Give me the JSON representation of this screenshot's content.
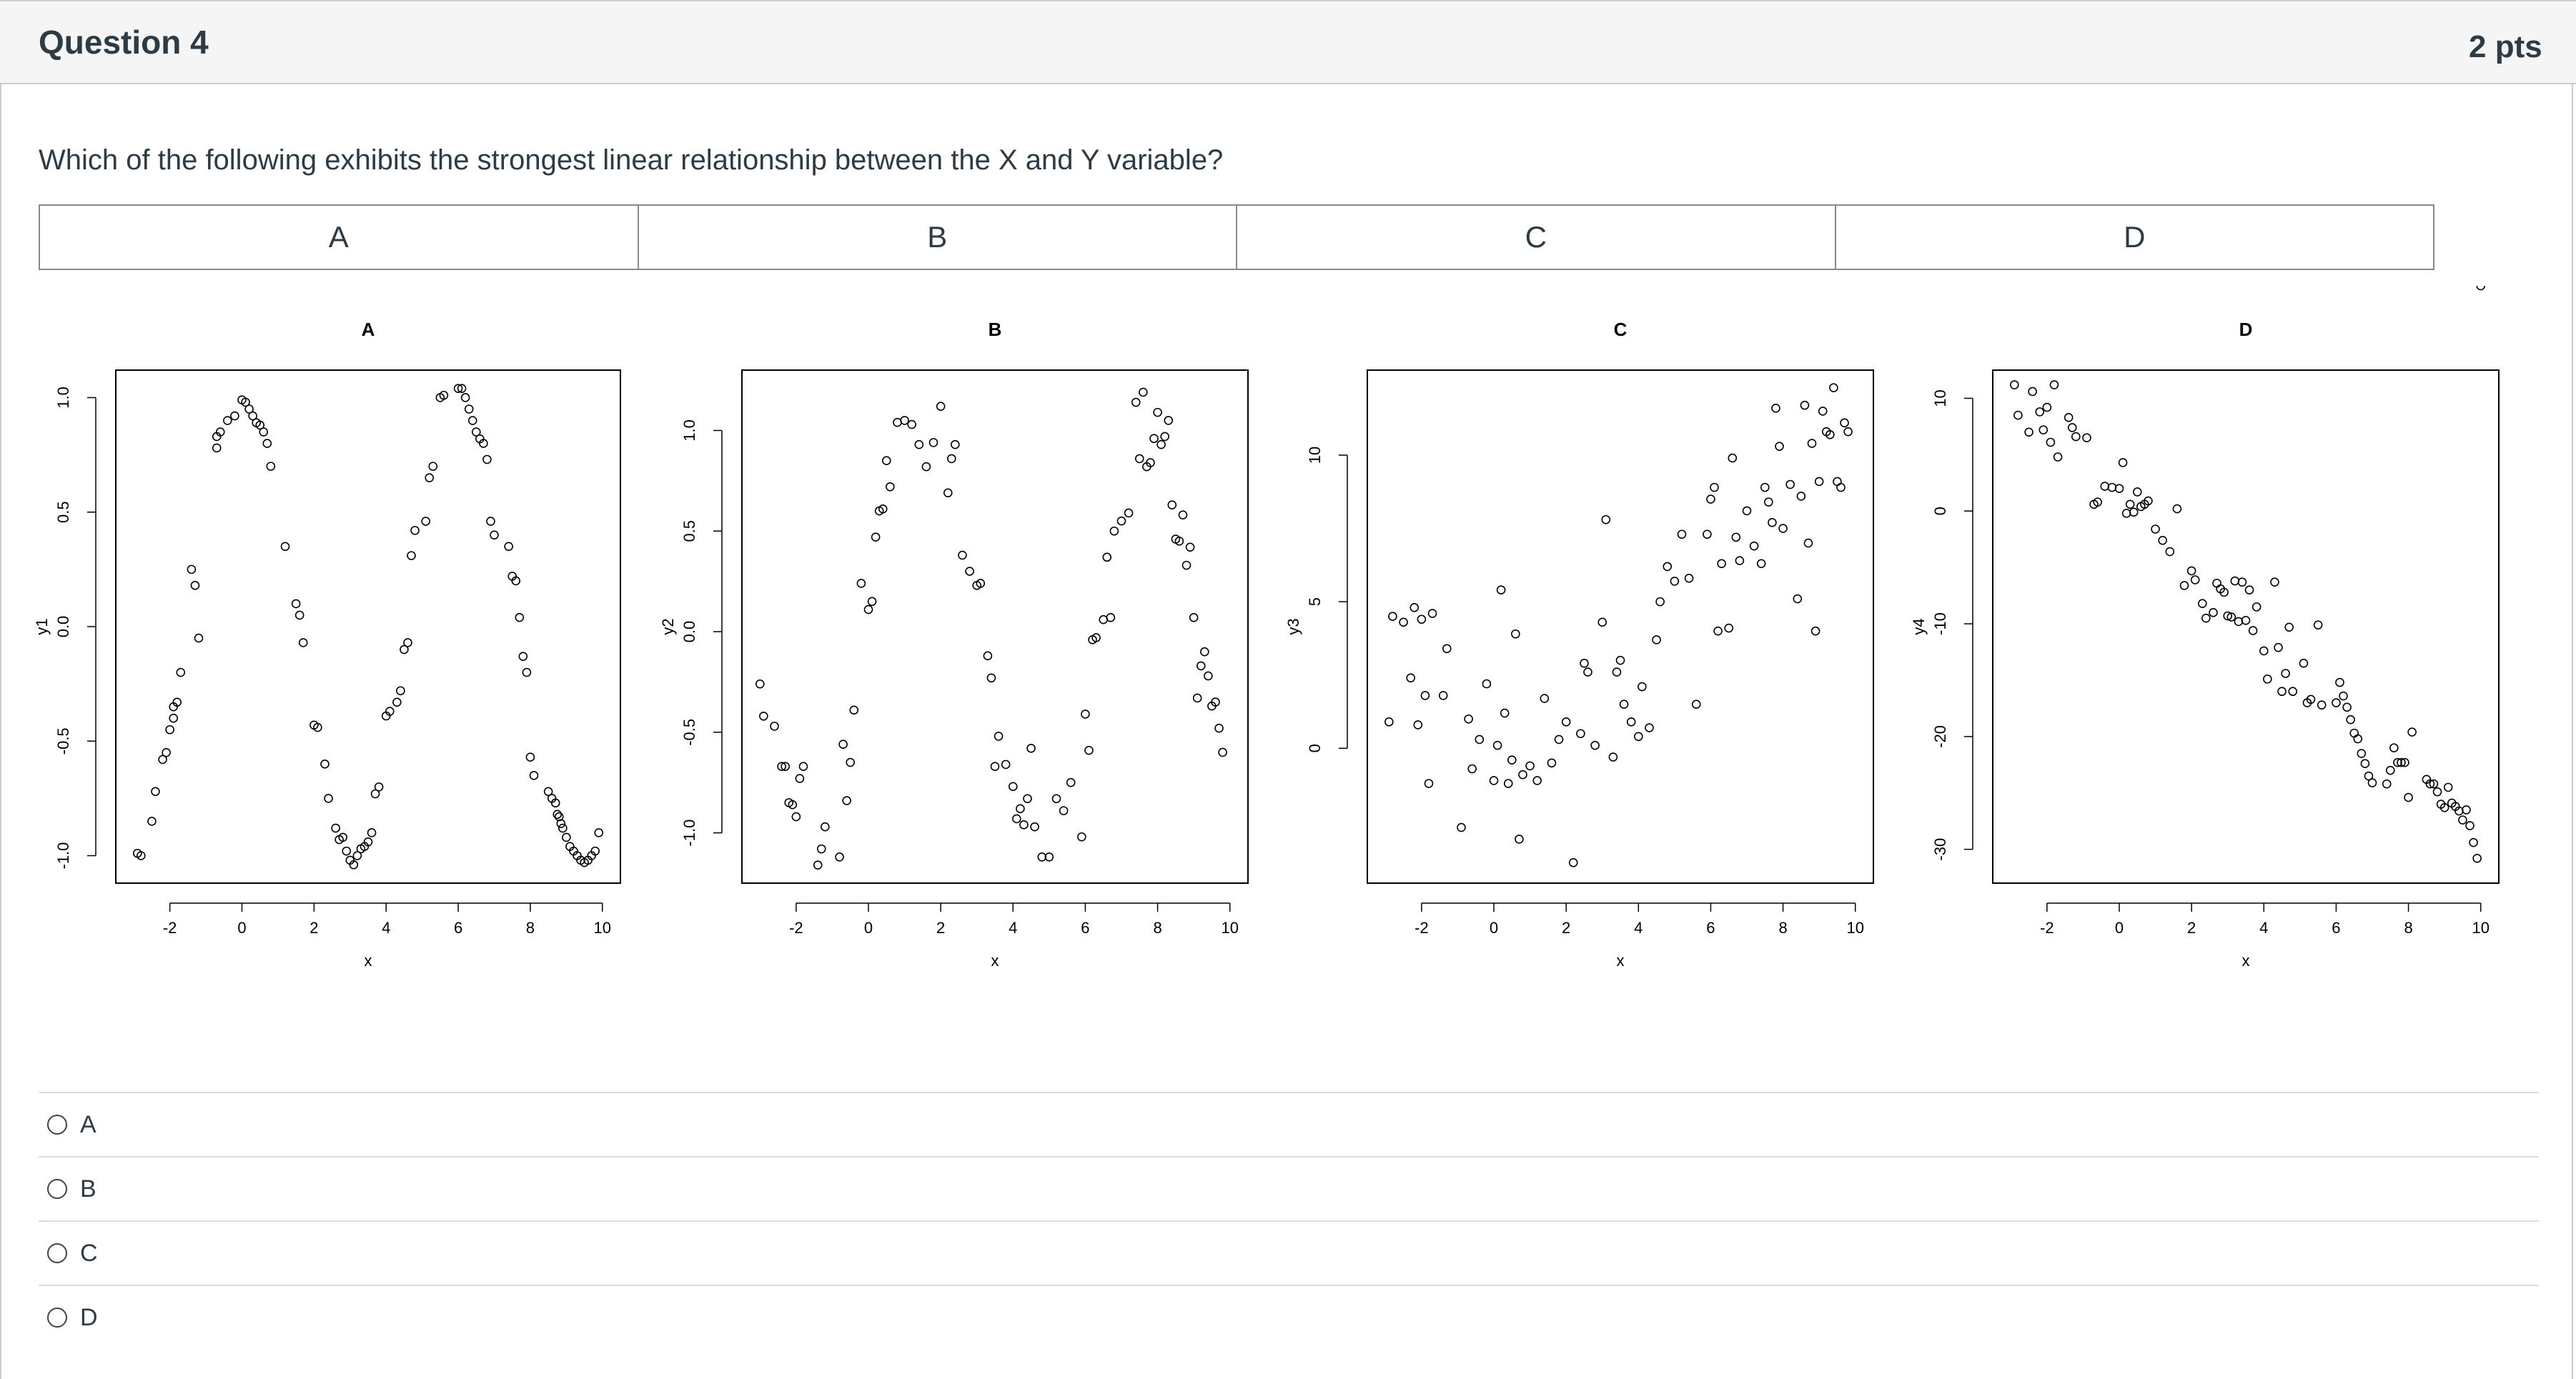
{
  "question": {
    "title": "Question 4",
    "points": "2 pts",
    "prompt": "Which of the following exhibits the strongest linear relationship between the X and Y variable?"
  },
  "label_table": [
    "A",
    "B",
    "C",
    "D"
  ],
  "answers": [
    {
      "label": "A",
      "selected": false
    },
    {
      "label": "B",
      "selected": false
    },
    {
      "label": "C",
      "selected": false
    },
    {
      "label": "D",
      "selected": false
    }
  ],
  "chart_data": [
    {
      "type": "scatter",
      "title": "A",
      "xlabel": "x",
      "ylabel": "y1",
      "xlim": [
        -3.5,
        10.5
      ],
      "ylim": [
        -1.12,
        1.12
      ],
      "xticks": [
        -2,
        0,
        2,
        4,
        6,
        8,
        10
      ],
      "yticks": [
        -1.0,
        -0.5,
        0.0,
        0.5,
        1.0
      ],
      "ytick_labels": [
        "-1.0",
        "-0.5",
        "0.0",
        "0.5",
        "1.0"
      ],
      "points": {
        "x": [
          -2.9,
          -2.8,
          -2.5,
          -2.4,
          -2.2,
          -2.1,
          -2.0,
          -1.9,
          -1.9,
          -1.8,
          -1.7,
          -1.4,
          -1.3,
          -1.2,
          -0.7,
          -0.7,
          -0.6,
          -0.4,
          -0.2,
          0.0,
          0.1,
          0.2,
          0.3,
          0.4,
          0.5,
          0.6,
          0.7,
          0.8,
          1.2,
          1.5,
          1.6,
          1.7,
          2.0,
          2.1,
          2.3,
          2.4,
          2.6,
          2.7,
          2.8,
          2.9,
          3.0,
          3.1,
          3.2,
          3.3,
          3.4,
          3.5,
          3.6,
          3.7,
          3.8,
          4.0,
          4.1,
          4.3,
          4.4,
          4.5,
          4.6,
          4.7,
          4.8,
          5.1,
          5.2,
          5.3,
          5.5,
          5.6,
          6.0,
          6.1,
          6.2,
          6.3,
          6.4,
          6.5,
          6.6,
          6.7,
          6.8,
          6.9,
          7.0,
          7.4,
          7.5,
          7.6,
          7.7,
          7.8,
          7.9,
          8.0,
          8.1,
          8.5,
          8.6,
          8.7,
          8.75,
          8.8,
          8.85,
          8.9,
          9.0,
          9.1,
          9.2,
          9.3,
          9.4,
          9.5,
          9.6,
          9.7,
          9.8,
          9.9
        ],
        "y": [
          -0.99,
          -1.0,
          -0.85,
          -0.72,
          -0.58,
          -0.55,
          -0.45,
          -0.4,
          -0.35,
          -0.33,
          -0.2,
          0.25,
          0.18,
          -0.05,
          0.78,
          0.83,
          0.85,
          0.9,
          0.92,
          0.99,
          0.98,
          0.95,
          0.92,
          0.89,
          0.88,
          0.85,
          0.8,
          0.7,
          0.35,
          0.1,
          0.05,
          -0.07,
          -0.43,
          -0.44,
          -0.6,
          -0.75,
          -0.88,
          -0.93,
          -0.92,
          -0.98,
          -1.02,
          -1.04,
          -1.0,
          -0.97,
          -0.96,
          -0.94,
          -0.9,
          -0.73,
          -0.7,
          -0.39,
          -0.37,
          -0.33,
          -0.28,
          -0.1,
          -0.07,
          0.31,
          0.42,
          0.46,
          0.65,
          0.7,
          1.0,
          1.01,
          1.04,
          1.04,
          1.0,
          0.95,
          0.9,
          0.85,
          0.82,
          0.8,
          0.73,
          0.46,
          0.4,
          0.35,
          0.22,
          0.2,
          0.04,
          -0.13,
          -0.2,
          -0.57,
          -0.65,
          -0.72,
          -0.75,
          -0.77,
          -0.82,
          -0.83,
          -0.86,
          -0.88,
          -0.92,
          -0.96,
          -0.98,
          -1.0,
          -1.02,
          -1.03,
          -1.02,
          -1.0,
          -0.98,
          -0.9
        ]
      }
    },
    {
      "type": "scatter",
      "title": "B",
      "xlabel": "x",
      "ylabel": "y2",
      "xlim": [
        -3.5,
        10.5
      ],
      "ylim": [
        -1.25,
        1.3
      ],
      "xticks": [
        -2,
        0,
        2,
        4,
        6,
        8,
        10
      ],
      "yticks": [
        -1.0,
        -0.5,
        0.0,
        0.5,
        1.0
      ],
      "ytick_labels": [
        "-1.0",
        "-0.5",
        "0.0",
        "0.5",
        "1.0"
      ],
      "points": {
        "x": [
          -3.0,
          -2.9,
          -2.6,
          -2.4,
          -2.3,
          -2.2,
          -2.1,
          -2.0,
          -1.9,
          -1.8,
          -1.4,
          -1.3,
          -1.2,
          -0.8,
          -0.7,
          -0.6,
          -0.5,
          -0.4,
          -0.2,
          0.0,
          0.1,
          0.2,
          0.3,
          0.4,
          0.5,
          0.6,
          0.8,
          1.0,
          1.2,
          1.4,
          1.6,
          1.8,
          2.0,
          2.2,
          2.3,
          2.4,
          2.6,
          2.8,
          3.0,
          3.1,
          3.3,
          3.4,
          3.5,
          3.6,
          3.8,
          4.0,
          4.1,
          4.2,
          4.3,
          4.4,
          4.5,
          4.6,
          4.8,
          5.0,
          5.2,
          5.4,
          5.6,
          5.9,
          6.0,
          6.1,
          6.2,
          6.3,
          6.5,
          6.6,
          6.7,
          6.8,
          7.0,
          7.2,
          7.4,
          7.5,
          7.6,
          7.7,
          7.8,
          7.9,
          8.0,
          8.1,
          8.2,
          8.3,
          8.4,
          8.5,
          8.6,
          8.7,
          8.8,
          8.9,
          9.0,
          9.1,
          9.2,
          9.3,
          9.4,
          9.5,
          9.6,
          9.7,
          9.8
        ],
        "y": [
          -0.26,
          -0.42,
          -0.47,
          -0.67,
          -0.67,
          -0.85,
          -0.86,
          -0.92,
          -0.73,
          -0.67,
          -1.16,
          -1.08,
          -0.97,
          -1.12,
          -0.56,
          -0.84,
          -0.65,
          -0.39,
          0.24,
          0.11,
          0.15,
          0.47,
          0.6,
          0.61,
          0.85,
          0.72,
          1.04,
          1.05,
          1.03,
          0.93,
          0.82,
          0.94,
          1.12,
          0.69,
          0.86,
          0.93,
          0.38,
          0.3,
          0.23,
          0.24,
          -0.12,
          -0.23,
          -0.67,
          -0.52,
          -0.66,
          -0.77,
          -0.93,
          -0.88,
          -0.96,
          -0.83,
          -0.58,
          -0.97,
          -1.12,
          -1.12,
          -0.83,
          -0.89,
          -0.75,
          -1.02,
          -0.41,
          -0.59,
          -0.04,
          -0.03,
          0.06,
          0.37,
          0.07,
          0.5,
          0.55,
          0.59,
          1.14,
          0.86,
          1.19,
          0.82,
          0.84,
          0.96,
          1.09,
          0.93,
          0.97,
          1.05,
          0.63,
          0.46,
          0.45,
          0.58,
          0.33,
          0.42,
          0.07,
          -0.33,
          -0.17,
          -0.1,
          -0.22,
          -0.37,
          -0.35,
          -0.48,
          -0.6
        ]
      }
    },
    {
      "type": "scatter",
      "title": "C",
      "xlabel": "x",
      "ylabel": "y3",
      "xlim": [
        -3.5,
        10.5
      ],
      "ylim": [
        -4.6,
        12.9
      ],
      "xticks": [
        -2,
        0,
        2,
        4,
        6,
        8,
        10
      ],
      "yticks": [
        0,
        5,
        10
      ],
      "ytick_labels": [
        "0",
        "5",
        "10"
      ],
      "points": {
        "x": [
          -2.9,
          -2.8,
          -2.5,
          -2.3,
          -2.2,
          -2.1,
          -2.0,
          -1.9,
          -1.8,
          -1.7,
          -1.4,
          -1.3,
          -0.9,
          -0.7,
          -0.6,
          -0.4,
          -0.2,
          0.0,
          0.1,
          0.2,
          0.3,
          0.4,
          0.5,
          0.6,
          0.7,
          0.8,
          1.0,
          1.2,
          1.4,
          1.6,
          1.8,
          2.0,
          2.2,
          2.4,
          2.5,
          2.6,
          2.8,
          3.0,
          3.1,
          3.3,
          3.4,
          3.5,
          3.6,
          3.8,
          4.0,
          4.1,
          4.3,
          4.5,
          4.6,
          4.8,
          5.0,
          5.2,
          5.4,
          5.6,
          5.9,
          6.0,
          6.1,
          6.2,
          6.3,
          6.5,
          6.6,
          6.7,
          6.8,
          7.0,
          7.2,
          7.4,
          7.5,
          7.6,
          7.7,
          7.8,
          7.9,
          8.0,
          8.2,
          8.4,
          8.5,
          8.6,
          8.7,
          8.8,
          8.9,
          9.0,
          9.1,
          9.2,
          9.3,
          9.4,
          9.5,
          9.6,
          9.7,
          9.8
        ],
        "y": [
          0.9,
          4.5,
          4.3,
          2.4,
          4.8,
          0.8,
          4.4,
          1.8,
          -1.2,
          4.6,
          1.8,
          3.4,
          -2.7,
          1.0,
          -0.7,
          0.3,
          2.2,
          -1.1,
          0.1,
          5.4,
          1.2,
          -1.2,
          -0.4,
          3.9,
          -3.1,
          -0.9,
          -0.6,
          -1.1,
          1.7,
          -0.5,
          0.3,
          0.9,
          -3.9,
          0.5,
          2.9,
          2.6,
          0.1,
          4.3,
          7.8,
          -0.3,
          2.6,
          3.0,
          1.5,
          0.9,
          0.4,
          2.1,
          0.7,
          3.7,
          5.0,
          6.2,
          5.7,
          7.3,
          5.8,
          1.5,
          7.3,
          8.5,
          8.9,
          4.0,
          6.3,
          4.1,
          9.9,
          7.2,
          6.4,
          8.1,
          6.9,
          6.3,
          8.9,
          8.4,
          7.7,
          11.6,
          10.3,
          7.5,
          9.0,
          5.1,
          8.6,
          11.7,
          7.0,
          10.4,
          4.0,
          9.1,
          11.5,
          10.8,
          10.7,
          12.3,
          9.1,
          8.9,
          11.1,
          10.8
        ]
      }
    },
    {
      "type": "scatter",
      "title": "D",
      "xlabel": "x",
      "ylabel": "y4",
      "xlim": [
        -3.5,
        10.5
      ],
      "ylim": [
        -33.0,
        12.5
      ],
      "xticks": [
        -2,
        0,
        2,
        4,
        6,
        8,
        10
      ],
      "yticks": [
        -30,
        -20,
        -10,
        0,
        10
      ],
      "ytick_labels": [
        "-30",
        "-20",
        "-10",
        "0",
        "10"
      ],
      "points": {
        "x": [
          -2.9,
          -2.8,
          -2.5,
          -2.4,
          -2.2,
          -2.1,
          -2.0,
          -1.9,
          -1.8,
          -1.7,
          -1.4,
          -1.3,
          -1.2,
          -0.9,
          -0.7,
          -0.6,
          -0.4,
          -0.2,
          0.0,
          0.1,
          0.2,
          0.3,
          0.4,
          0.5,
          0.6,
          0.7,
          0.8,
          1.0,
          1.2,
          1.4,
          1.6,
          1.8,
          2.0,
          2.1,
          2.3,
          2.4,
          2.6,
          2.7,
          2.8,
          2.9,
          3.0,
          3.1,
          3.2,
          3.3,
          3.4,
          3.5,
          3.6,
          3.7,
          3.8,
          4.0,
          4.1,
          4.3,
          4.4,
          4.5,
          4.6,
          4.7,
          4.8,
          5.1,
          5.2,
          5.3,
          5.5,
          5.6,
          6.0,
          6.1,
          6.2,
          6.3,
          6.4,
          6.5,
          6.6,
          6.7,
          6.8,
          6.9,
          7.0,
          7.4,
          7.5,
          7.6,
          7.7,
          7.8,
          7.9,
          8.0,
          8.1,
          8.5,
          8.6,
          8.7,
          8.8,
          8.9,
          9.0,
          9.1,
          9.2,
          9.3,
          9.4,
          9.5,
          9.6,
          9.7,
          9.8,
          9.9,
          10.0
        ],
        "y": [
          11.2,
          8.5,
          7.0,
          10.6,
          8.8,
          7.2,
          9.2,
          6.1,
          11.2,
          4.8,
          8.3,
          7.4,
          6.6,
          6.5,
          0.6,
          0.8,
          2.2,
          2.1,
          2.0,
          4.3,
          -0.2,
          0.6,
          -0.1,
          1.7,
          0.4,
          0.6,
          0.9,
          -1.6,
          -2.6,
          -3.6,
          0.2,
          -6.6,
          -5.3,
          -6.1,
          -8.2,
          -9.5,
          -9.0,
          -6.4,
          -6.9,
          -7.2,
          -9.3,
          -9.4,
          -6.2,
          -9.8,
          -6.3,
          -9.7,
          -7.0,
          -10.6,
          -8.5,
          -12.4,
          -14.9,
          -6.3,
          -12.1,
          -16.0,
          -14.4,
          -10.3,
          -16.0,
          -13.5,
          -17.0,
          -16.7,
          -10.1,
          -17.2,
          -17.0,
          -15.2,
          -16.4,
          -17.4,
          -18.5,
          -19.7,
          -20.2,
          -21.5,
          -22.4,
          -23.5,
          -24.1,
          -24.2,
          -23.0,
          -21.0,
          -22.3,
          -22.3,
          -22.3,
          -25.4,
          -19.6,
          -23.8,
          -24.2,
          -24.2,
          -24.9,
          -26.0,
          -26.3,
          -24.5,
          -25.9,
          -26.2,
          -26.6,
          -27.4,
          -26.5,
          -27.9,
          -29.4,
          -30.8
        ]
      }
    }
  ]
}
